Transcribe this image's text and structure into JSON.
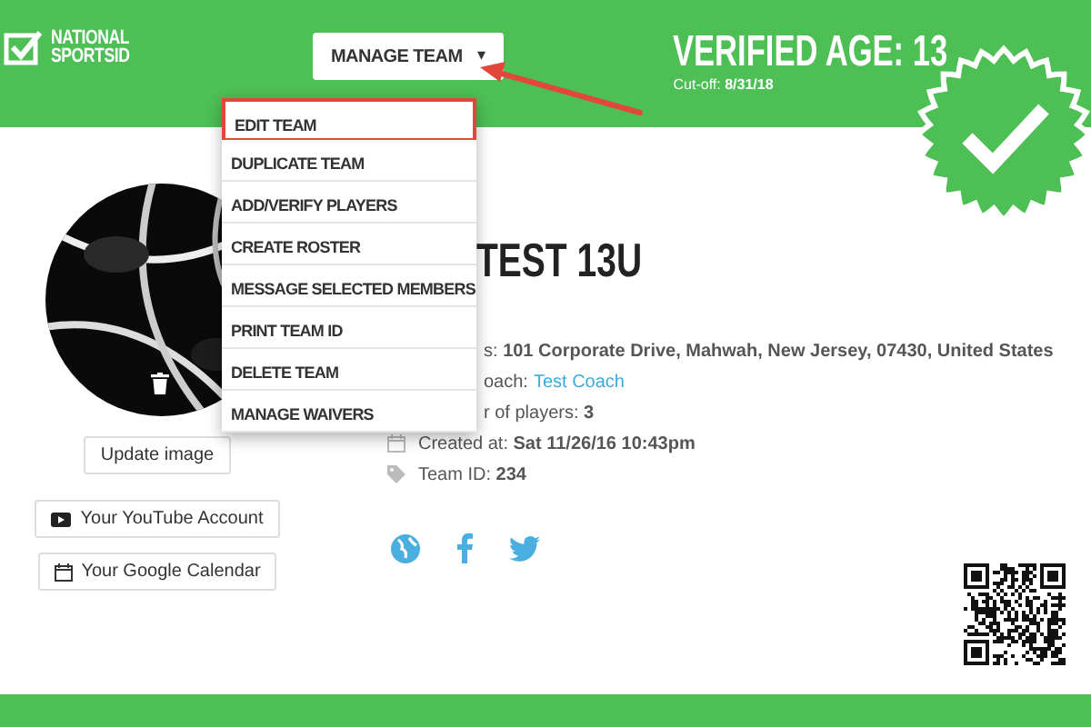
{
  "logo": {
    "lines": [
      "NATIONAL",
      "SPORTSID"
    ]
  },
  "manage_button": {
    "label": "MANAGE TEAM",
    "caret": "▾"
  },
  "verified": {
    "title": "VERIFIED AGE: 13",
    "cutoff": "Cut-off: **8/31/18**"
  },
  "dropdown": [
    {
      "label": "EDIT TEAM",
      "selected": true
    },
    {
      "label": "DUPLICATE TEAM",
      "selected": false
    },
    {
      "label": "ADD/VERIFY PLAYERS",
      "selected": false
    },
    {
      "label": "CREATE ROSTER",
      "selected": false
    },
    {
      "label": "MESSAGE SELECTED MEMBERS",
      "selected": false
    },
    {
      "label": "PRINT TEAM ID",
      "selected": false
    },
    {
      "label": "DELETE TEAM",
      "selected": false
    },
    {
      "label": "MANAGE WAIVERS",
      "selected": false
    }
  ],
  "team_name": "TEST 13U",
  "details": [
    {
      "kind": "cut",
      "text": "s: **101 Corporate Drive, Mahwah, New Jersey, 07430, United States**"
    },
    {
      "kind": "cut",
      "text": "oach:",
      "link": "Test Coach"
    },
    {
      "kind": "cut",
      "text": "r of players: **3**"
    },
    {
      "kind": "calendar",
      "text": "Created at: **Sat 11/26/16 10:43pm**"
    },
    {
      "kind": "tag",
      "text": "Team ID: **234**"
    }
  ],
  "update_button": "Update image",
  "account_buttons": [
    {
      "kind": "youtube",
      "label": "Your YouTube Account"
    },
    {
      "kind": "calendar",
      "label": "Your Google Calendar"
    }
  ]
}
